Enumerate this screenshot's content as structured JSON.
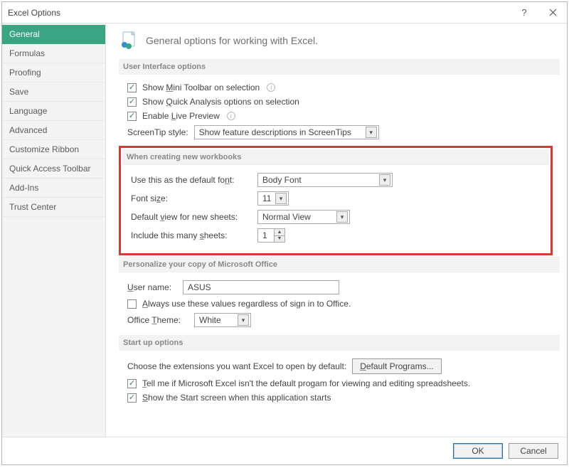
{
  "window": {
    "title": "Excel Options"
  },
  "sidebar": {
    "items": [
      {
        "label": "General"
      },
      {
        "label": "Formulas"
      },
      {
        "label": "Proofing"
      },
      {
        "label": "Save"
      },
      {
        "label": "Language"
      },
      {
        "label": "Advanced"
      },
      {
        "label": "Customize Ribbon"
      },
      {
        "label": "Quick Access Toolbar"
      },
      {
        "label": "Add-Ins"
      },
      {
        "label": "Trust Center"
      }
    ],
    "selected_index": 0
  },
  "header": {
    "text": "General options for working with Excel."
  },
  "sections": {
    "ui": {
      "title": "User Interface options",
      "mini_toolbar": "Show Mini Toolbar on selection",
      "quick_analysis": "Show Quick Analysis options on selection",
      "live_preview": "Enable Live Preview",
      "screentip_label": "ScreenTip style:",
      "screentip_value": "Show feature descriptions in ScreenTips"
    },
    "newwb": {
      "title": "When creating new workbooks",
      "font_label": "Use this as the default font:",
      "font_value": "Body Font",
      "size_label": "Font size:",
      "size_value": "11",
      "view_label": "Default view for new sheets:",
      "view_value": "Normal View",
      "sheets_label": "Include this many sheets:",
      "sheets_value": "1"
    },
    "personalize": {
      "title": "Personalize your copy of Microsoft Office",
      "user_label": "User name:",
      "user_value": "ASUS",
      "always_label": "Always use these values regardless of sign in to Office.",
      "theme_label": "Office Theme:",
      "theme_value": "White"
    },
    "startup": {
      "title": "Start up options",
      "ext_label": "Choose the extensions you want Excel to open by default:",
      "default_programs_btn": "Default Programs...",
      "tellme_label": "Tell me if Microsoft Excel isn't the default progam for viewing and editing spreadsheets.",
      "show_start_label": "Show the Start screen when this application starts"
    }
  },
  "footer": {
    "ok": "OK",
    "cancel": "Cancel"
  }
}
